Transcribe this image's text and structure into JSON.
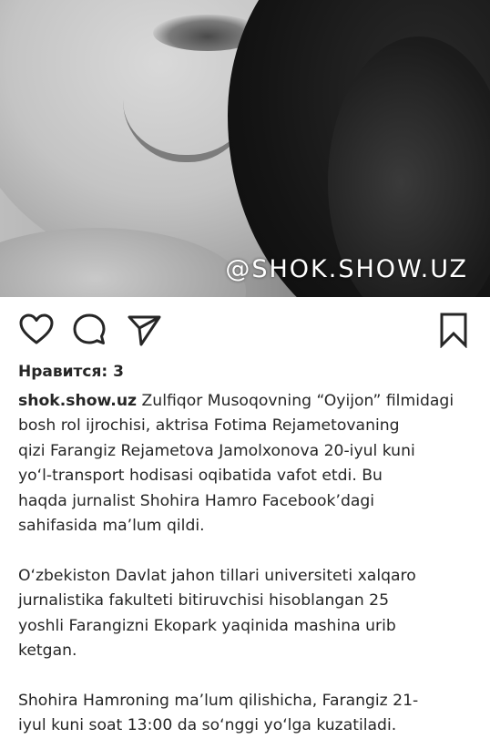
{
  "photo": {
    "watermark": "@SHOK.SHOW.UZ"
  },
  "actions": {
    "like_icon": "heart-outline-icon",
    "comment_icon": "comment-bubble-icon",
    "share_icon": "paper-plane-icon",
    "save_icon": "bookmark-outline-icon"
  },
  "likes": {
    "label": "Нравится: 3"
  },
  "caption": {
    "username": "shok.show.uz",
    "lines": [
      " Zulfiqor Musoqovning “Oyijon” filmidagi",
      "bosh rol ijrochisi, aktrisa Fotima Rejametovaning",
      "qizi Farangiz Rejametova Jamolxonova 20-iyul kuni",
      "yo‘l-transport hodisasi oqibatida vafot etdi. Bu",
      "haqda jurnalist Shohira Hamro Facebook’dagi",
      "sahifasida ma’lum qildi.",
      "",
      "O‘zbekiston Davlat jahon tillari universiteti xalqaro",
      "jurnalistika fakulteti bitiruvchisi hisoblangan 25",
      "yoshli Farangizni Ekopark yaqinida mashina urib",
      "ketgan.",
      "",
      "Shohira Hamroning ma’lum qilishicha, Farangiz 21-",
      "iyul kuni soat 13:00 da so‘nggi yo‘lga kuzatiladi."
    ]
  },
  "colors": {
    "text": "#262626",
    "background": "#ffffff"
  }
}
